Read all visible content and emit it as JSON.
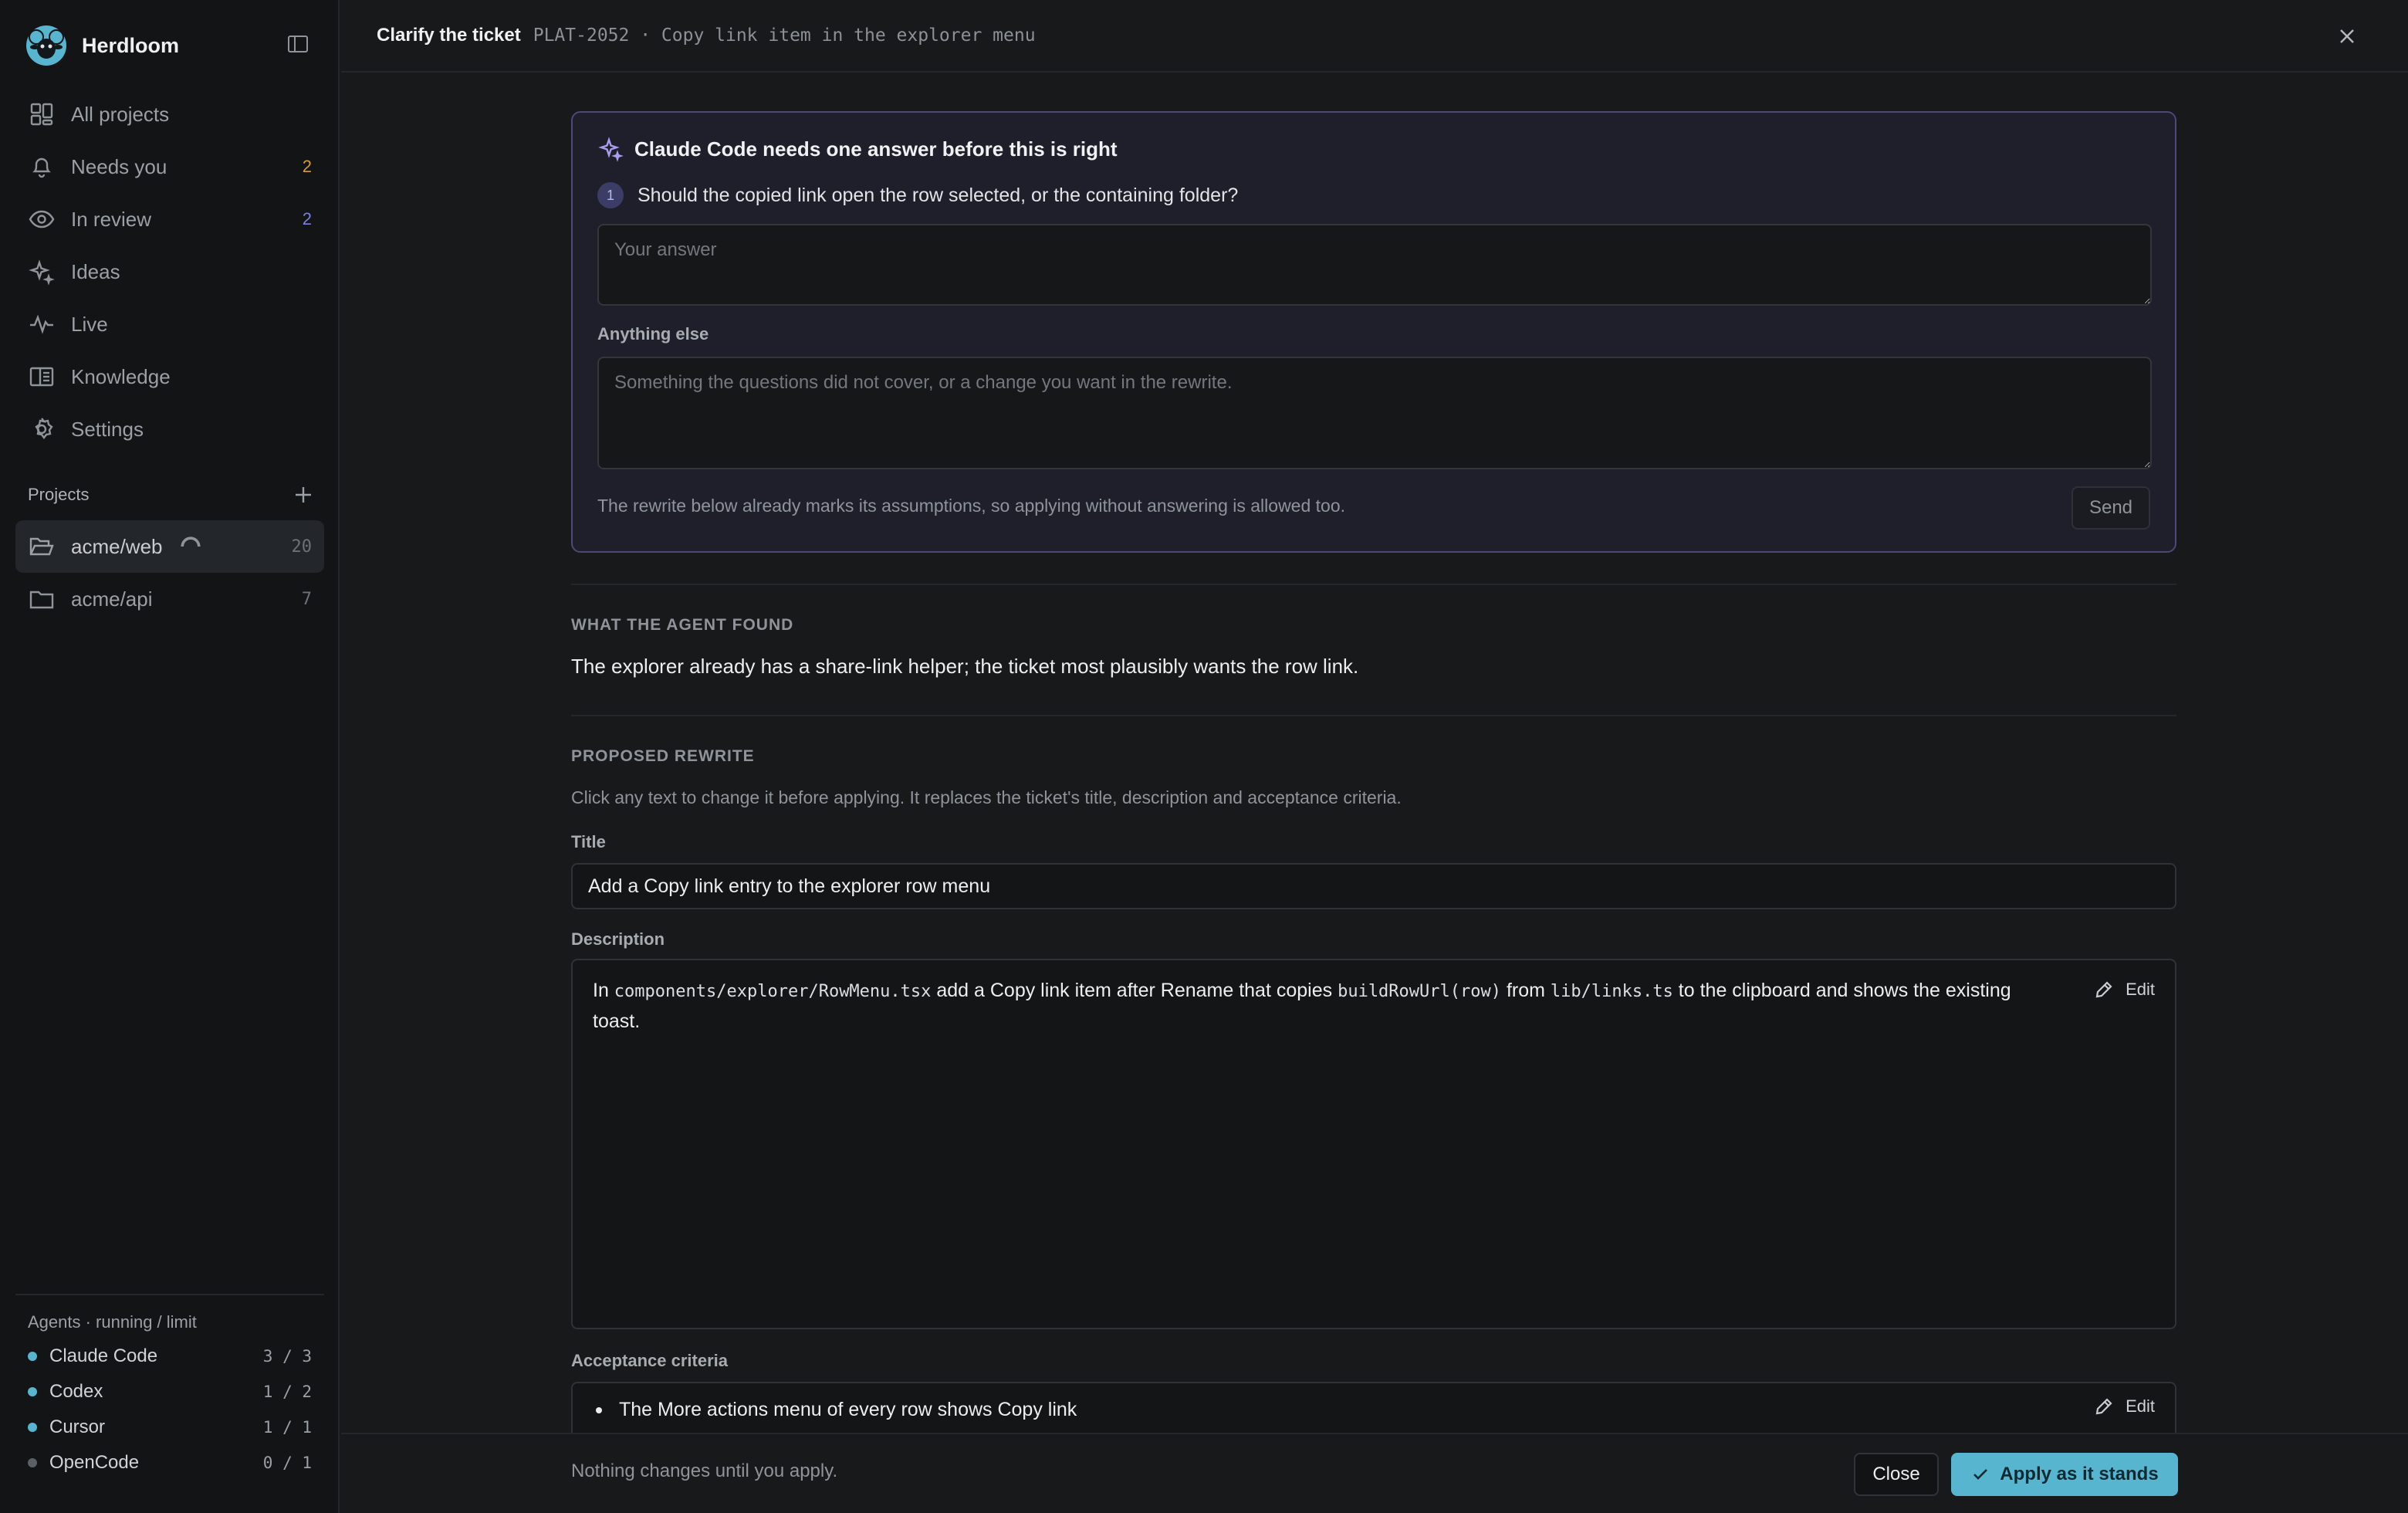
{
  "app": {
    "name": "Herdloom"
  },
  "sidebar": {
    "nav": [
      {
        "label": "All projects",
        "icon": "grid-icon",
        "count": ""
      },
      {
        "label": "Needs you",
        "icon": "bell-icon",
        "count": "2"
      },
      {
        "label": "In review",
        "icon": "eye-icon",
        "count": "2"
      },
      {
        "label": "Ideas",
        "icon": "sparkle-icon",
        "count": ""
      },
      {
        "label": "Live",
        "icon": "activity-icon",
        "count": ""
      },
      {
        "label": "Knowledge",
        "icon": "book-icon",
        "count": ""
      },
      {
        "label": "Settings",
        "icon": "gear-icon",
        "count": ""
      }
    ],
    "projects_label": "Projects",
    "projects": [
      {
        "name": "acme/web",
        "count": "20"
      },
      {
        "name": "acme/api",
        "count": "7"
      }
    ],
    "agents_title": "Agents · running / limit",
    "agents": [
      {
        "name": "Claude Code",
        "usage": "3 / 3",
        "color": "#58b5cf"
      },
      {
        "name": "Codex",
        "usage": "1 / 2",
        "color": "#58b5cf"
      },
      {
        "name": "Cursor",
        "usage": "1 / 1",
        "color": "#58b5cf"
      },
      {
        "name": "OpenCode",
        "usage": "0 / 1",
        "color": "#5b6066"
      }
    ]
  },
  "header": {
    "title": "Clarify the ticket",
    "subtitle": "PLAT-2052 · Copy link item in the explorer menu"
  },
  "ask": {
    "heading": "Claude Code needs one answer before this is right",
    "question_number": "1",
    "question": "Should the copied link open the row selected, or the containing folder?",
    "answer_placeholder": "Your answer",
    "else_label": "Anything else",
    "else_placeholder": "Something the questions did not cover, or a change you want in the rewrite.",
    "footnote": "The rewrite below already marks its assumptions, so applying without answering is allowed too.",
    "send_label": "Send"
  },
  "found": {
    "label": "WHAT THE AGENT FOUND",
    "text": "The explorer already has a share-link helper; the ticket most plausibly wants the row link."
  },
  "rewrite": {
    "label": "PROPOSED REWRITE",
    "hint": "Click any text to change it before applying. It replaces the ticket's title, description and acceptance criteria.",
    "title_label": "Title",
    "title_value": "Add a Copy link entry to the explorer row menu",
    "description_label": "Description",
    "description": {
      "t1": "In ",
      "c1": "components/explorer/RowMenu.tsx",
      "t2": " add a Copy link item after Rename that copies ",
      "c2": "buildRowUrl(row)",
      "t3": " from ",
      "c3": "lib/links.ts",
      "t4": " to the clipboard and shows the existing toast."
    },
    "edit_label": "Edit",
    "criteria_label": "Acceptance criteria",
    "criteria": [
      "The More actions menu of every row shows Copy link"
    ]
  },
  "footer": {
    "note": "Nothing changes until you apply.",
    "close_label": "Close",
    "apply_label": "Apply as it stands"
  }
}
